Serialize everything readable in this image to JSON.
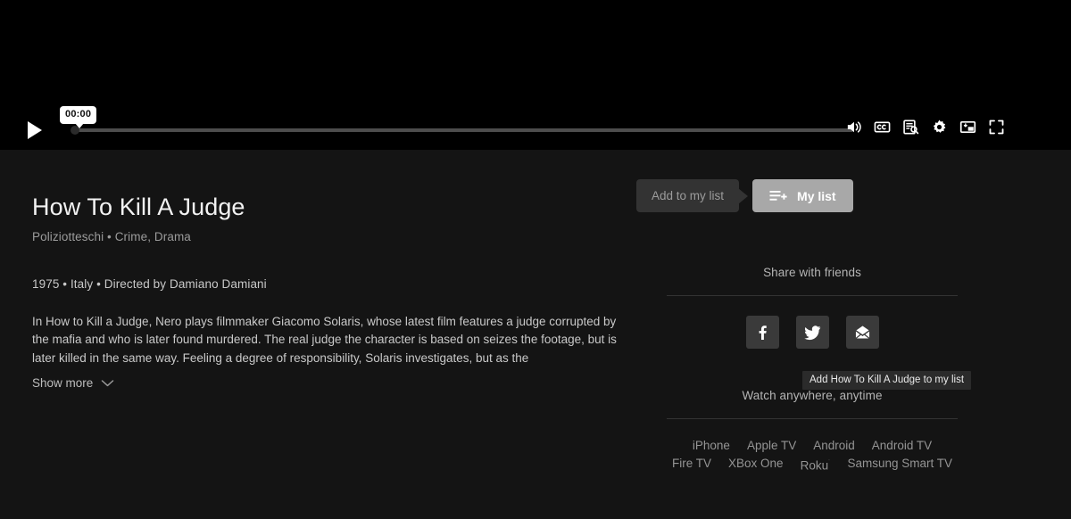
{
  "player": {
    "play_label": "play-icon",
    "time_tooltip": "00:00",
    "progress_percent": 0,
    "controls": [
      {
        "name": "volume-icon",
        "label": "Volume"
      },
      {
        "name": "closed-captions-icon",
        "label": "CC"
      },
      {
        "name": "subtitles-search-icon",
        "label": "Subtitles"
      },
      {
        "name": "gear-icon",
        "label": "Settings"
      },
      {
        "name": "picture-in-picture-icon",
        "label": "Picture in picture"
      },
      {
        "name": "fullscreen-icon",
        "label": "Fullscreen"
      }
    ]
  },
  "detail": {
    "title": "How To Kill A Judge",
    "subtitle": "Poliziotteschi • Crime, Drama",
    "meta": "1975 • Italy • Directed by Damiano Damiani",
    "synopsis": "In How to Kill a Judge, Nero plays filmmaker Giacomo Solaris, whose latest film features a judge corrupted by the mafia and who is later found murdered. The real judge the character is based on seizes the footage, but is later killed in the same way. Feeling a degree of responsibility, Solaris investigates, but as the",
    "show_more": "Show more"
  },
  "list_actions": {
    "add_label": "Add to my list",
    "my_list_label": "My list",
    "tooltip": "Add How To Kill A Judge to my list"
  },
  "share": {
    "heading": "Share with friends",
    "buttons": [
      {
        "name": "facebook-icon",
        "label": "Facebook"
      },
      {
        "name": "twitter-icon",
        "label": "Twitter"
      },
      {
        "name": "email-icon",
        "label": "Email"
      }
    ]
  },
  "devices": {
    "heading": "Watch anywhere, anytime",
    "row1": [
      "iPhone",
      "Apple TV",
      "Android",
      "Android TV"
    ],
    "row2": [
      "Fire TV",
      "XBox One",
      "Roku",
      "Samsung Smart TV"
    ],
    "roku_mark": "˙"
  },
  "colors": {
    "player_background": "#000000",
    "page_background": "#141414",
    "accent": "#e50914",
    "button_active": "#a8a8a8",
    "button_inactive": "#333333"
  }
}
